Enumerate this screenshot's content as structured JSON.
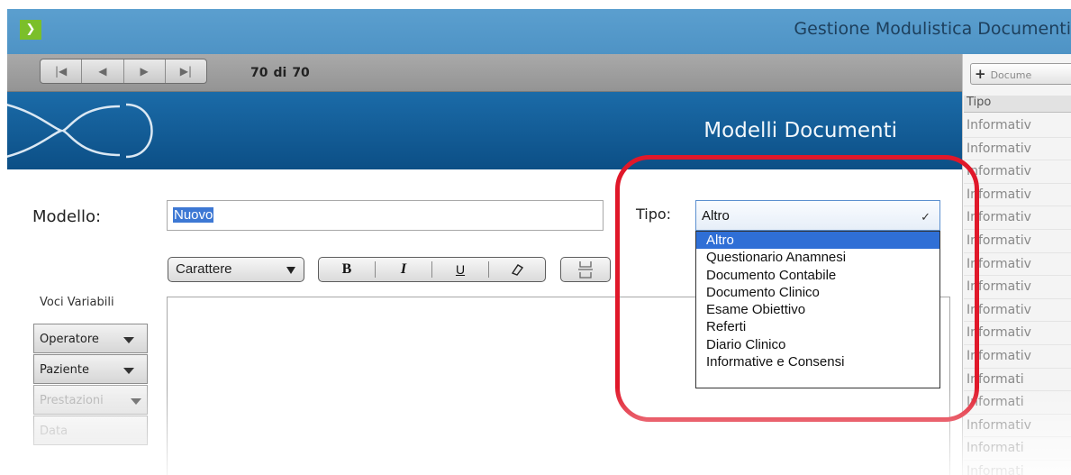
{
  "window": {
    "title": "Gestione Modulistica Documenti"
  },
  "nav": {
    "counter_current": "70",
    "counter_sep": "di",
    "counter_total": "70"
  },
  "banner": {
    "title": "Modelli Documenti"
  },
  "form": {
    "modello_label": "Modello:",
    "modello_value": "Nuovo",
    "tipo_label": "Tipo:",
    "tipo_value": "Altro",
    "tipo_options": [
      "Altro",
      "Questionario Anamnesi",
      "Documento Contabile",
      "Documento Clinico",
      "Esame Obiettivo",
      "Referti",
      "Diario Clinico",
      "Informative e Consensi"
    ]
  },
  "toolbar": {
    "font_select": "Carattere",
    "bold": "B",
    "italic": "I",
    "underline": "U"
  },
  "variables": {
    "title": "Voci Variabili",
    "buttons": [
      "Operatore",
      "Paziente",
      "Prestazioni",
      "Data"
    ]
  },
  "right_panel": {
    "new_doc_button": "Docume",
    "column_header": "Tipo",
    "rows": [
      "Informativ",
      "Informativ",
      "Informativ",
      "Informativ",
      "Informativ",
      "Informativ",
      "Informativ",
      "Informativ",
      "Informativ",
      "Informativ",
      "Informativ",
      "Informati",
      "Informati",
      "Informativ",
      "Informati",
      "Informati"
    ]
  },
  "colors": {
    "titlebar": "#5b9fcf",
    "banner": "#1b6ba8",
    "selection": "#2f6fd6",
    "highlight_outline": "#e0182a",
    "logo": "#7bbf2a"
  }
}
